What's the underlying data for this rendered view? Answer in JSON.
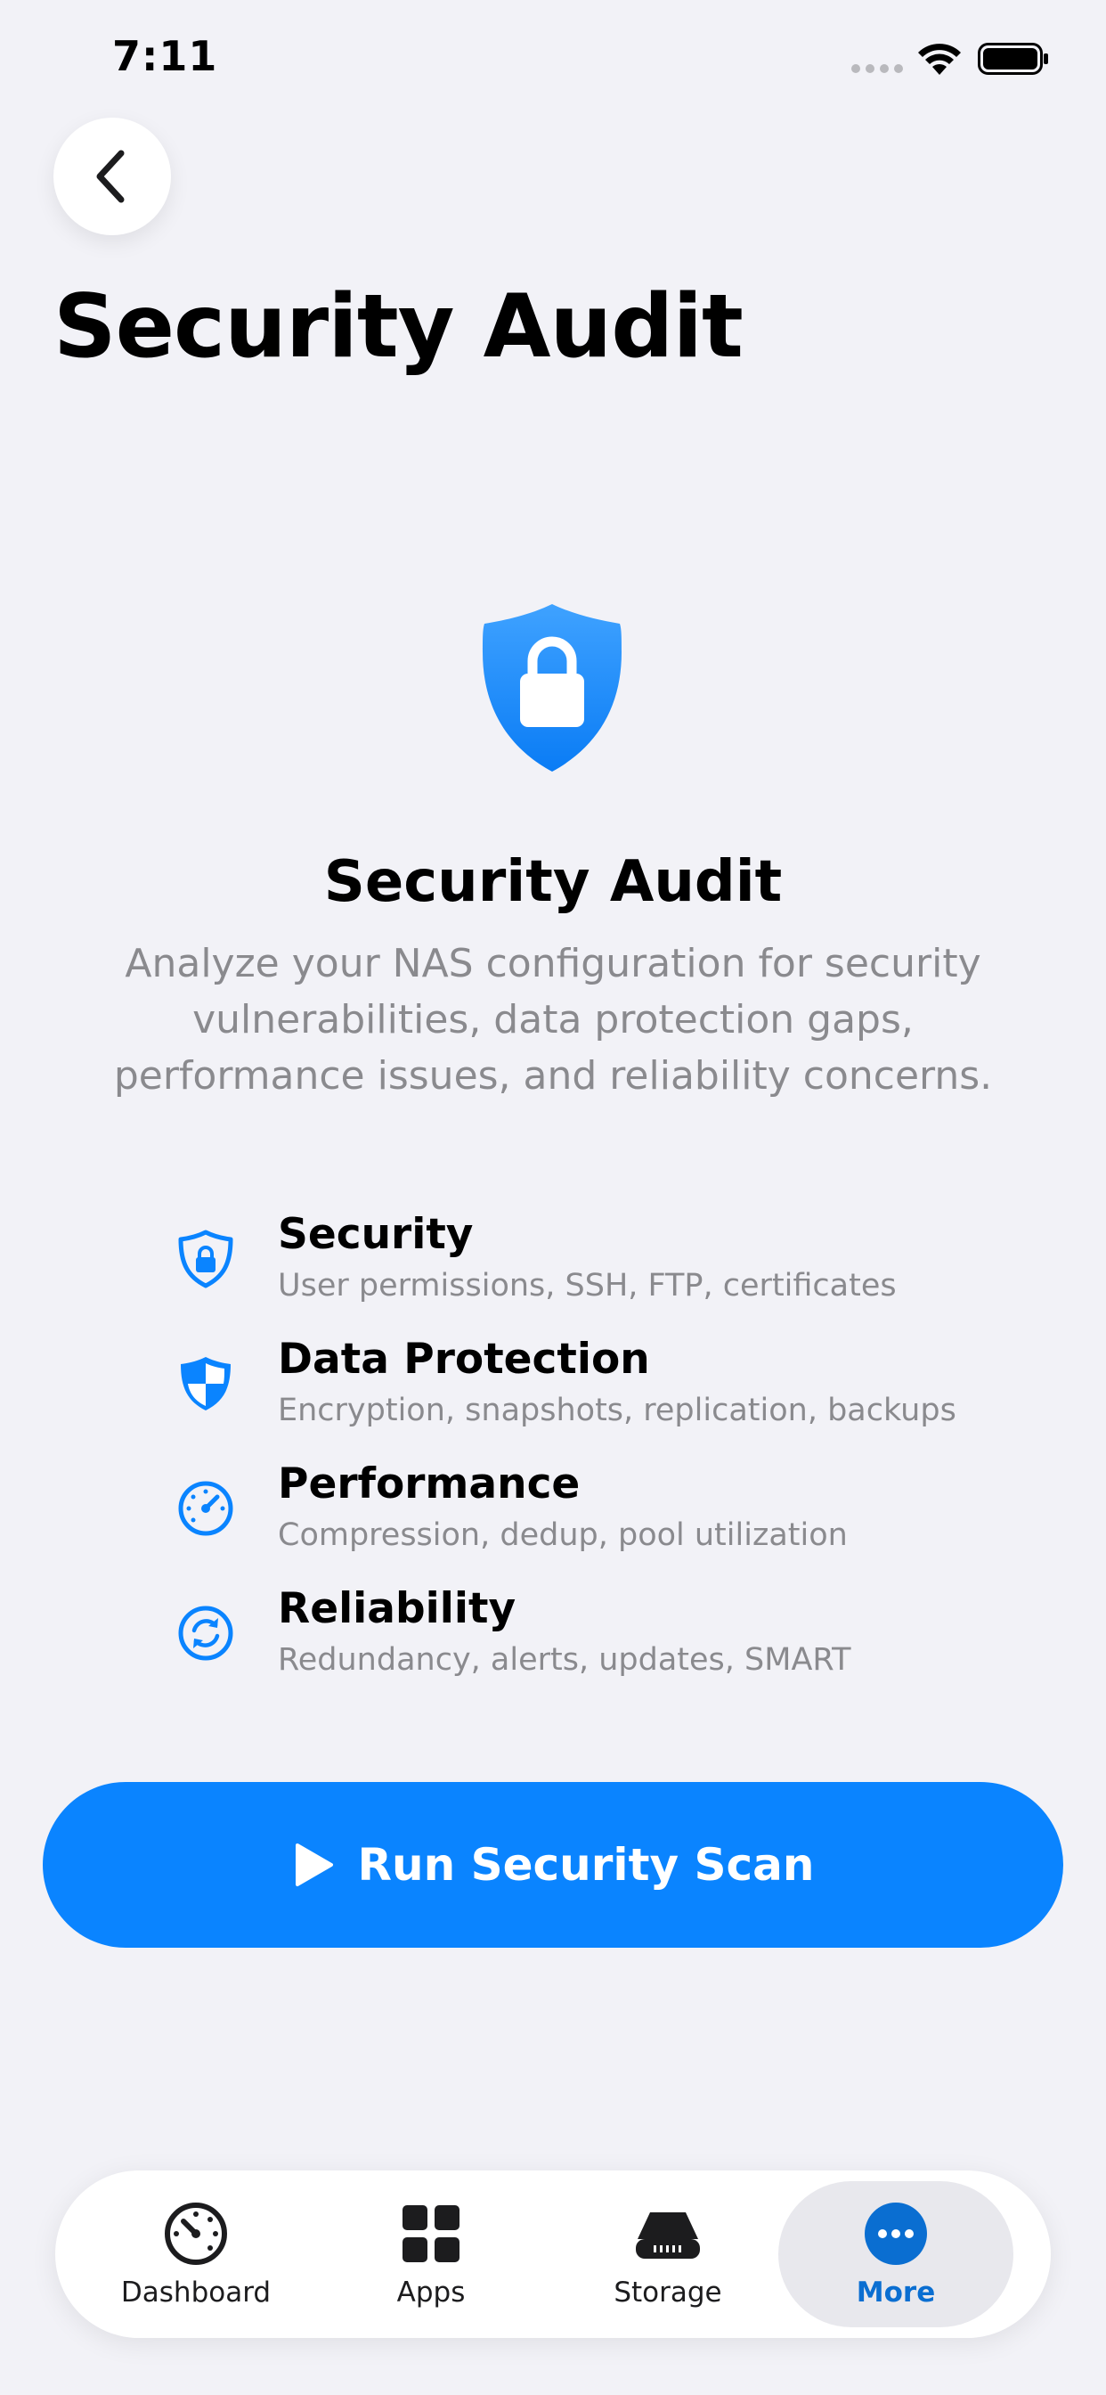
{
  "status_bar": {
    "time": "7:11"
  },
  "header": {
    "title": "Security Audit"
  },
  "hero": {
    "title": "Security Audit",
    "description": "Analyze your NAS configuration for security vulnerabilities, data protection gaps, performance issues, and reliability concerns."
  },
  "features": [
    {
      "title": "Security",
      "subtitle": "User permissions, SSH, FTP, certificates",
      "icon": "lock-shield-icon"
    },
    {
      "title": "Data Protection",
      "subtitle": "Encryption, snapshots, replication, backups",
      "icon": "checkered-shield-icon"
    },
    {
      "title": "Performance",
      "subtitle": "Compression, dedup, pool utilization",
      "icon": "gauge-icon"
    },
    {
      "title": "Reliability",
      "subtitle": "Redundancy, alerts, updates, SMART",
      "icon": "refresh-icon"
    }
  ],
  "actions": {
    "run_label": "Run Security Scan"
  },
  "tabs": [
    {
      "label": "Dashboard",
      "icon": "gauge-icon",
      "active": false
    },
    {
      "label": "Apps",
      "icon": "grid-icon",
      "active": false
    },
    {
      "label": "Storage",
      "icon": "drive-icon",
      "active": false
    },
    {
      "label": "More",
      "icon": "ellipsis-circle-icon",
      "active": true
    }
  ],
  "colors": {
    "accent": "#0A84FF",
    "background": "#F2F2F7",
    "secondary_text": "#8A8A8E",
    "active_tab_label": "#0A6ED1"
  }
}
